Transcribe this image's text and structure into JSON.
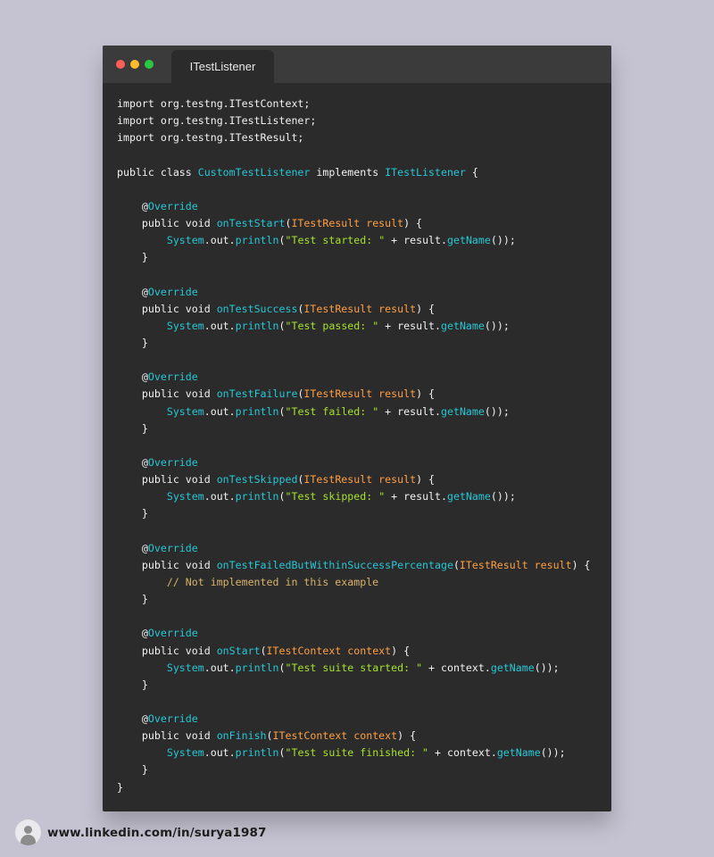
{
  "window": {
    "tab_title": "ITestListener"
  },
  "colors": {
    "background": "#c5c3d1",
    "editor": "#2b2b2b",
    "titlebar": "#3b3b3b",
    "keyword": "#f2f2f2",
    "type": "#ff9f43",
    "function": "#27c7d6",
    "string": "#a6e22e",
    "comment": "#d7b36a"
  },
  "code": {
    "lines": [
      [
        {
          "t": "import",
          "c": "kw"
        },
        {
          "t": " org.testng.ITestContext;",
          "c": "punc"
        }
      ],
      [
        {
          "t": "import",
          "c": "kw"
        },
        {
          "t": " org.testng.ITestListener;",
          "c": "punc"
        }
      ],
      [
        {
          "t": "import",
          "c": "kw"
        },
        {
          "t": " org.testng.ITestResult;",
          "c": "punc"
        }
      ],
      [],
      [
        {
          "t": "public class ",
          "c": "kw"
        },
        {
          "t": "CustomTestListener",
          "c": "fn"
        },
        {
          "t": " implements ",
          "c": "kw"
        },
        {
          "t": "ITestListener",
          "c": "fn"
        },
        {
          "t": " {",
          "c": "punc"
        }
      ],
      [],
      [
        {
          "t": "    @",
          "c": "at"
        },
        {
          "t": "Override",
          "c": "fn"
        }
      ],
      [
        {
          "t": "    public void ",
          "c": "kw"
        },
        {
          "t": "onTestStart",
          "c": "fn"
        },
        {
          "t": "(",
          "c": "punc"
        },
        {
          "t": "ITestResult result",
          "c": "type"
        },
        {
          "t": ") {",
          "c": "punc"
        }
      ],
      [
        {
          "t": "        ",
          "c": "punc"
        },
        {
          "t": "System",
          "c": "fn"
        },
        {
          "t": ".out.",
          "c": "punc"
        },
        {
          "t": "println",
          "c": "fn"
        },
        {
          "t": "(",
          "c": "punc"
        },
        {
          "t": "\"Test started: \"",
          "c": "str"
        },
        {
          "t": " + result.",
          "c": "punc"
        },
        {
          "t": "getName",
          "c": "fn"
        },
        {
          "t": "());",
          "c": "punc"
        }
      ],
      [
        {
          "t": "    }",
          "c": "punc"
        }
      ],
      [],
      [
        {
          "t": "    @",
          "c": "at"
        },
        {
          "t": "Override",
          "c": "fn"
        }
      ],
      [
        {
          "t": "    public void ",
          "c": "kw"
        },
        {
          "t": "onTestSuccess",
          "c": "fn"
        },
        {
          "t": "(",
          "c": "punc"
        },
        {
          "t": "ITestResult result",
          "c": "type"
        },
        {
          "t": ") {",
          "c": "punc"
        }
      ],
      [
        {
          "t": "        ",
          "c": "punc"
        },
        {
          "t": "System",
          "c": "fn"
        },
        {
          "t": ".out.",
          "c": "punc"
        },
        {
          "t": "println",
          "c": "fn"
        },
        {
          "t": "(",
          "c": "punc"
        },
        {
          "t": "\"Test passed: \"",
          "c": "str"
        },
        {
          "t": " + result.",
          "c": "punc"
        },
        {
          "t": "getName",
          "c": "fn"
        },
        {
          "t": "());",
          "c": "punc"
        }
      ],
      [
        {
          "t": "    }",
          "c": "punc"
        }
      ],
      [],
      [
        {
          "t": "    @",
          "c": "at"
        },
        {
          "t": "Override",
          "c": "fn"
        }
      ],
      [
        {
          "t": "    public void ",
          "c": "kw"
        },
        {
          "t": "onTestFailure",
          "c": "fn"
        },
        {
          "t": "(",
          "c": "punc"
        },
        {
          "t": "ITestResult result",
          "c": "type"
        },
        {
          "t": ") {",
          "c": "punc"
        }
      ],
      [
        {
          "t": "        ",
          "c": "punc"
        },
        {
          "t": "System",
          "c": "fn"
        },
        {
          "t": ".out.",
          "c": "punc"
        },
        {
          "t": "println",
          "c": "fn"
        },
        {
          "t": "(",
          "c": "punc"
        },
        {
          "t": "\"Test failed: \"",
          "c": "str"
        },
        {
          "t": " + result.",
          "c": "punc"
        },
        {
          "t": "getName",
          "c": "fn"
        },
        {
          "t": "());",
          "c": "punc"
        }
      ],
      [
        {
          "t": "    }",
          "c": "punc"
        }
      ],
      [],
      [
        {
          "t": "    @",
          "c": "at"
        },
        {
          "t": "Override",
          "c": "fn"
        }
      ],
      [
        {
          "t": "    public void ",
          "c": "kw"
        },
        {
          "t": "onTestSkipped",
          "c": "fn"
        },
        {
          "t": "(",
          "c": "punc"
        },
        {
          "t": "ITestResult result",
          "c": "type"
        },
        {
          "t": ") {",
          "c": "punc"
        }
      ],
      [
        {
          "t": "        ",
          "c": "punc"
        },
        {
          "t": "System",
          "c": "fn"
        },
        {
          "t": ".out.",
          "c": "punc"
        },
        {
          "t": "println",
          "c": "fn"
        },
        {
          "t": "(",
          "c": "punc"
        },
        {
          "t": "\"Test skipped: \"",
          "c": "str"
        },
        {
          "t": " + result.",
          "c": "punc"
        },
        {
          "t": "getName",
          "c": "fn"
        },
        {
          "t": "());",
          "c": "punc"
        }
      ],
      [
        {
          "t": "    }",
          "c": "punc"
        }
      ],
      [],
      [
        {
          "t": "    @",
          "c": "at"
        },
        {
          "t": "Override",
          "c": "fn"
        }
      ],
      [
        {
          "t": "    public void ",
          "c": "kw"
        },
        {
          "t": "onTestFailedButWithinSuccessPercentage",
          "c": "fn"
        },
        {
          "t": "(",
          "c": "punc"
        },
        {
          "t": "ITestResult result",
          "c": "type"
        },
        {
          "t": ") {",
          "c": "punc"
        }
      ],
      [
        {
          "t": "        // Not implemented in this example",
          "c": "comment"
        }
      ],
      [
        {
          "t": "    }",
          "c": "punc"
        }
      ],
      [],
      [
        {
          "t": "    @",
          "c": "at"
        },
        {
          "t": "Override",
          "c": "fn"
        }
      ],
      [
        {
          "t": "    public void ",
          "c": "kw"
        },
        {
          "t": "onStart",
          "c": "fn"
        },
        {
          "t": "(",
          "c": "punc"
        },
        {
          "t": "ITestContext context",
          "c": "type"
        },
        {
          "t": ") {",
          "c": "punc"
        }
      ],
      [
        {
          "t": "        ",
          "c": "punc"
        },
        {
          "t": "System",
          "c": "fn"
        },
        {
          "t": ".out.",
          "c": "punc"
        },
        {
          "t": "println",
          "c": "fn"
        },
        {
          "t": "(",
          "c": "punc"
        },
        {
          "t": "\"Test suite started: \"",
          "c": "str"
        },
        {
          "t": " + context.",
          "c": "punc"
        },
        {
          "t": "getName",
          "c": "fn"
        },
        {
          "t": "());",
          "c": "punc"
        }
      ],
      [
        {
          "t": "    }",
          "c": "punc"
        }
      ],
      [],
      [
        {
          "t": "    @",
          "c": "at"
        },
        {
          "t": "Override",
          "c": "fn"
        }
      ],
      [
        {
          "t": "    public void ",
          "c": "kw"
        },
        {
          "t": "onFinish",
          "c": "fn"
        },
        {
          "t": "(",
          "c": "punc"
        },
        {
          "t": "ITestContext context",
          "c": "type"
        },
        {
          "t": ") {",
          "c": "punc"
        }
      ],
      [
        {
          "t": "        ",
          "c": "punc"
        },
        {
          "t": "System",
          "c": "fn"
        },
        {
          "t": ".out.",
          "c": "punc"
        },
        {
          "t": "println",
          "c": "fn"
        },
        {
          "t": "(",
          "c": "punc"
        },
        {
          "t": "\"Test suite finished: \"",
          "c": "str"
        },
        {
          "t": " + context.",
          "c": "punc"
        },
        {
          "t": "getName",
          "c": "fn"
        },
        {
          "t": "());",
          "c": "punc"
        }
      ],
      [
        {
          "t": "    }",
          "c": "punc"
        }
      ],
      [
        {
          "t": "}",
          "c": "punc"
        }
      ]
    ]
  },
  "footer": {
    "avatar_icon": "user-avatar-icon",
    "profile_text": "www.linkedin.com/in/surya1987"
  }
}
